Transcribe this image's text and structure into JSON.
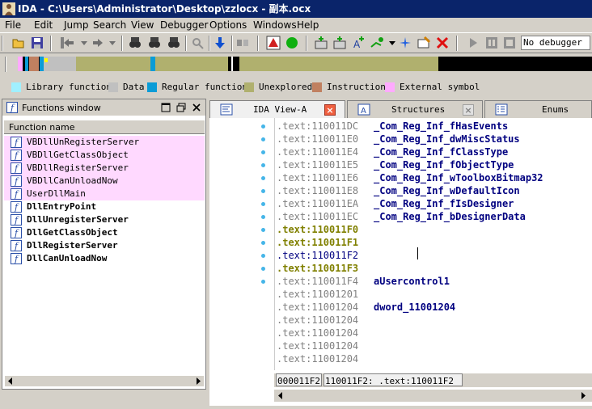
{
  "window": {
    "title": "IDA - C:\\Users\\Administrator\\Desktop\\zzlocx - 副本.ocx"
  },
  "menu": [
    "File",
    "Edit",
    "Jump",
    "Search",
    "View",
    "Debugger",
    "Options",
    "Windows",
    "Help"
  ],
  "toolbar": {
    "debugger_select": "No debugger",
    "icons": [
      "open-icon",
      "save-icon",
      "back-icon",
      "forward-icon",
      "hex-icon",
      "struct-icon",
      "enum-icon",
      "search-icon",
      "jump-icon",
      "cfg-icon",
      "segment-icon",
      "plugin-icon",
      "run-icon",
      "pause-icon",
      "stop-icon"
    ]
  },
  "legend": {
    "items": [
      {
        "label": "Library function",
        "color": "#a0f0ff"
      },
      {
        "label": "Data",
        "color": "#c0c0c0"
      },
      {
        "label": "Regular function",
        "color": "#0a9cd7"
      },
      {
        "label": "Unexplored",
        "color": "#b0b06e"
      },
      {
        "label": "Instruction",
        "color": "#c08060"
      },
      {
        "label": "External symbol",
        "color": "#ffaaff"
      }
    ]
  },
  "functions_window": {
    "title": "Functions window",
    "column_header": "Function name",
    "items": [
      {
        "name": "VBDllUnRegisterServer",
        "type": "library"
      },
      {
        "name": "VBDllGetClassObject",
        "type": "library"
      },
      {
        "name": "VBDllRegisterServer",
        "type": "library"
      },
      {
        "name": "VBDllCanUnloadNow",
        "type": "library"
      },
      {
        "name": "UserDllMain",
        "type": "library"
      },
      {
        "name": "DllEntryPoint",
        "type": "regular"
      },
      {
        "name": "DllUnregisterServer",
        "type": "regular"
      },
      {
        "name": "DllGetClassObject",
        "type": "regular"
      },
      {
        "name": "DllRegisterServer",
        "type": "regular"
      },
      {
        "name": "DllCanUnloadNow",
        "type": "regular"
      }
    ]
  },
  "tabs": [
    {
      "label": "IDA View-A",
      "active": true
    },
    {
      "label": "Structures",
      "active": false
    },
    {
      "label": "Enums",
      "active": false
    }
  ],
  "ida_view": {
    "lines": [
      {
        "addr": ".text:110011DC",
        "sym": "_Com_Reg_Inf_fHasEvents",
        "style": "gray"
      },
      {
        "addr": ".text:110011E0",
        "sym": "_Com_Reg_Inf_dwMiscStatus",
        "style": "gray"
      },
      {
        "addr": ".text:110011E4",
        "sym": "_Com_Reg_Inf_fClassType",
        "style": "gray"
      },
      {
        "addr": ".text:110011E5",
        "sym": "_Com_Reg_Inf_fObjectType",
        "style": "gray"
      },
      {
        "addr": ".text:110011E6",
        "sym": "_Com_Reg_Inf_wToolboxBitmap32",
        "style": "gray"
      },
      {
        "addr": ".text:110011E8",
        "sym": "_Com_Reg_Inf_wDefaultIcon",
        "style": "gray"
      },
      {
        "addr": ".text:110011EA",
        "sym": "_Com_Reg_Inf_fIsDesigner",
        "style": "gray"
      },
      {
        "addr": ".text:110011EC",
        "sym": "_Com_Reg_Inf_bDesignerData",
        "style": "gray"
      },
      {
        "addr": ".text:110011F0",
        "sym": "",
        "style": "olive"
      },
      {
        "addr": ".text:110011F1",
        "sym": "",
        "style": "olive"
      },
      {
        "addr": ".text:110011F2",
        "sym": "",
        "style": "blue"
      },
      {
        "addr": ".text:110011F3",
        "sym": "",
        "style": "olive"
      },
      {
        "addr": ".text:110011F4",
        "sym": "aUsercontrol1",
        "style": "gray"
      },
      {
        "addr": ".text:11001201",
        "sym": "",
        "style": "gray"
      },
      {
        "addr": ".text:11001204",
        "sym": "dword_11001204",
        "style": "gray"
      },
      {
        "addr": ".text:11001204",
        "sym": "",
        "style": "gray"
      },
      {
        "addr": ".text:11001204",
        "sym": "",
        "style": "gray"
      },
      {
        "addr": ".text:11001204",
        "sym": "",
        "style": "gray"
      },
      {
        "addr": ".text:11001204",
        "sym": "",
        "style": "gray"
      }
    ],
    "status_offset": "000011F2",
    "status_location": "110011F2: .text:110011F2"
  }
}
